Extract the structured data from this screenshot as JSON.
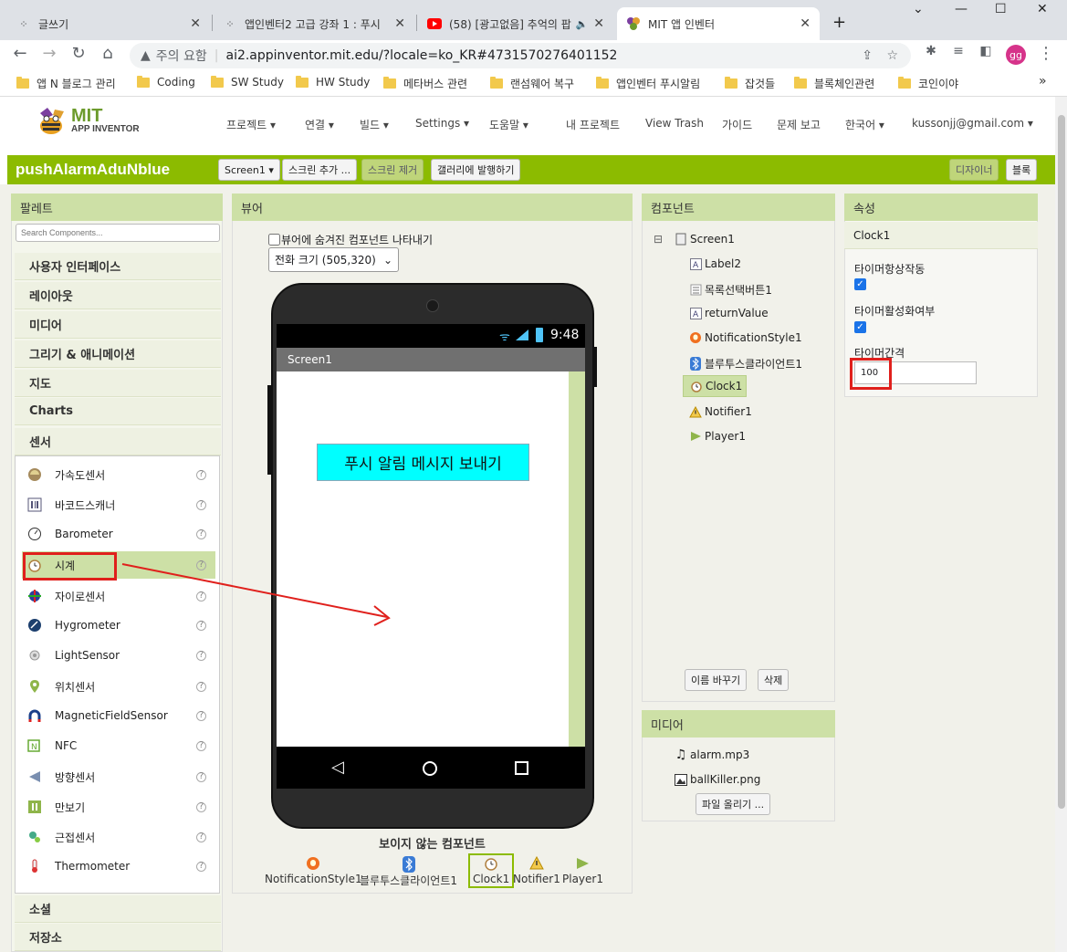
{
  "browser": {
    "tabs": [
      {
        "title": "글쓰기",
        "icon": "tistory-icon"
      },
      {
        "title": "앱인벤터2 고급 강좌 1 : 푸시",
        "icon": "tistory-icon"
      },
      {
        "title": "(58) [광고없음] 추억의 팝",
        "icon": "youtube-icon"
      },
      {
        "title": "MIT 앱 인벤터",
        "icon": "appinventor-icon"
      }
    ],
    "url_warning": "주의 요함",
    "url": "ai2.appinventor.mit.edu/?locale=ko_KR#4731570276401152",
    "profile": "gg",
    "bookmarks": [
      "앱 N 블로그 관리",
      "Coding",
      "SW Study",
      "HW Study",
      "메타버스 관련",
      "랜섬웨어 복구",
      "앱인벤터 푸시알림",
      "잡것들",
      "블록체인관련",
      "코인이야"
    ],
    "bookmarks_more": "»"
  },
  "header": {
    "logo_mit": "MIT",
    "logo_sub": "APP INVENTOR",
    "menus": [
      "프로젝트 ▾",
      "연결 ▾",
      "빌드 ▾",
      "Settings ▾",
      "도움말 ▾",
      "내 프로젝트",
      "View Trash",
      "가이드",
      "문제 보고",
      "한국어 ▾",
      "kussonjj@gmail.com ▾"
    ]
  },
  "project": {
    "name": "pushAlarmAduNblue",
    "screen_select": "Screen1 ▾",
    "add_screen": "스크린 추가 ...",
    "remove_screen": "스크린 제거",
    "publish": "갤러리에 발행하기",
    "designer": "디자이너",
    "blocks": "블록"
  },
  "palette": {
    "title": "팔레트",
    "search_placeholder": "Search Components...",
    "categories_top": [
      "사용자 인터페이스",
      "레이아웃",
      "미디어",
      "그리기 & 애니메이션",
      "지도",
      "Charts",
      "센서"
    ],
    "sensors": [
      {
        "label": "가속도센서",
        "icon": "accelerometer-icon"
      },
      {
        "label": "바코드스캐너",
        "icon": "barcode-icon"
      },
      {
        "label": "Barometer",
        "icon": "barometer-icon"
      },
      {
        "label": "시계",
        "icon": "clock-icon"
      },
      {
        "label": "자이로센서",
        "icon": "gyroscope-icon"
      },
      {
        "label": "Hygrometer",
        "icon": "hygrometer-icon"
      },
      {
        "label": "LightSensor",
        "icon": "light-icon"
      },
      {
        "label": "위치센서",
        "icon": "location-icon"
      },
      {
        "label": "MagneticFieldSensor",
        "icon": "magnet-icon"
      },
      {
        "label": "NFC",
        "icon": "nfc-icon"
      },
      {
        "label": "방향센서",
        "icon": "orientation-icon"
      },
      {
        "label": "만보기",
        "icon": "pedometer-icon"
      },
      {
        "label": "근접센서",
        "icon": "proximity-icon"
      },
      {
        "label": "Thermometer",
        "icon": "thermometer-icon"
      }
    ],
    "categories_bottom": [
      "소셜",
      "저장소"
    ],
    "help": "?"
  },
  "viewer": {
    "title": "뷰어",
    "show_hidden": "뷰어에 숨겨진 컴포넌트 나타내기",
    "phone_size": "전화 크기 (505,320)",
    "status_time": "9:48",
    "screen_title": "Screen1",
    "label_text": "푸시 알림 메시지 보내기",
    "nonvisible_title": "보이지 않는 컴포넌트",
    "nonvisible": [
      {
        "label": "NotificationStyle1",
        "icon": "notification-icon"
      },
      {
        "label": "블루투스클라이언트1",
        "icon": "bluetooth-icon"
      },
      {
        "label": "Clock1",
        "icon": "clock-icon"
      },
      {
        "label": "Notifier1",
        "icon": "warning-icon"
      },
      {
        "label": "Player1",
        "icon": "play-icon"
      }
    ]
  },
  "components": {
    "title": "컴포넌트",
    "root": "Screen1",
    "items": [
      {
        "label": "Label2",
        "icon": "label-icon"
      },
      {
        "label": "목록선택버튼1",
        "icon": "listpicker-icon"
      },
      {
        "label": "returnValue",
        "icon": "label-icon"
      },
      {
        "label": "NotificationStyle1",
        "icon": "notification-icon"
      },
      {
        "label": "블루투스클라이언트1",
        "icon": "bluetooth-icon"
      },
      {
        "label": "Clock1",
        "icon": "clock-icon"
      },
      {
        "label": "Notifier1",
        "icon": "warning-icon"
      },
      {
        "label": "Player1",
        "icon": "play-icon"
      }
    ],
    "rename": "이름 바꾸기",
    "delete": "삭제"
  },
  "media": {
    "title": "미디어",
    "files": [
      {
        "label": "alarm.mp3",
        "icon": "music-icon"
      },
      {
        "label": "ballKiller.png",
        "icon": "image-icon"
      }
    ],
    "upload": "파일 올리기 ..."
  },
  "properties": {
    "title": "속성",
    "component": "Clock1",
    "always_fires_label": "타이머항상작동",
    "enabled_label": "타이머활성화여부",
    "interval_label": "타이머간격",
    "interval_value": "100"
  },
  "colors": {
    "accent": "#8cbb00",
    "panel_header": "#cde0a6",
    "label_bg": "#00ffff",
    "annotation": "#e0201c"
  }
}
